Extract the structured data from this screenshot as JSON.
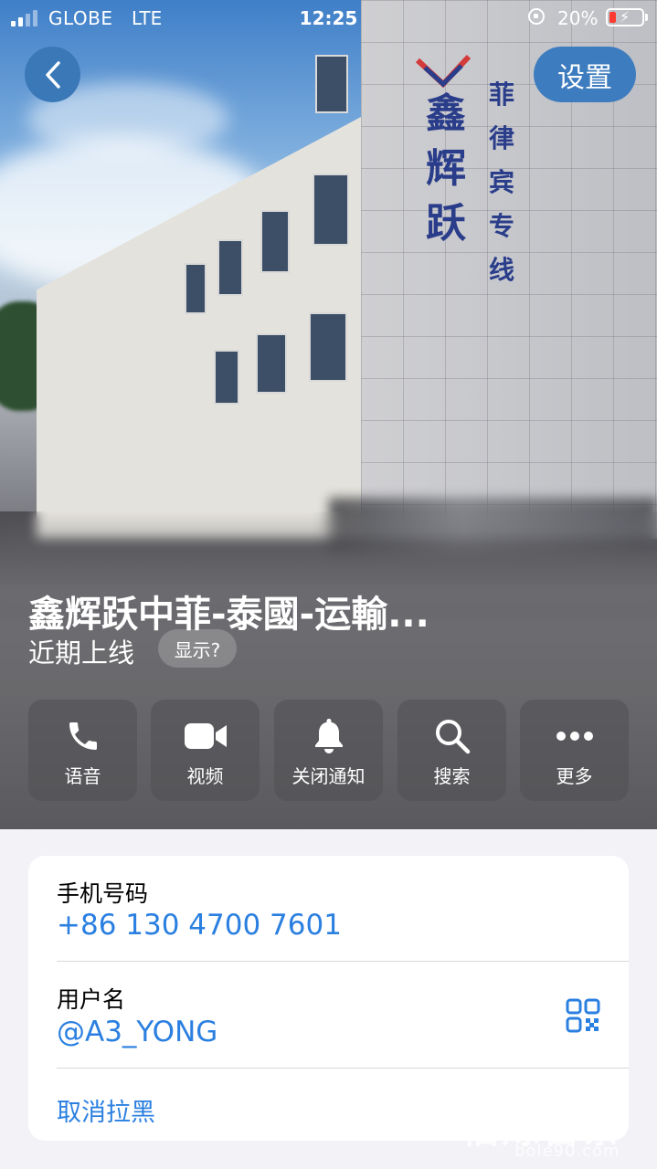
{
  "status_bar": {
    "carrier": "GLOBE",
    "network": "LTE",
    "time": "12:25",
    "battery_percent_label": "20%",
    "battery_level": 0.2,
    "battery_color": "#ff3b30",
    "signal_bars_active": 2
  },
  "nav": {
    "back_icon": "chevron-left-icon",
    "settings_label": "设置"
  },
  "contact": {
    "name": "鑫辉跃中菲-泰國-运輸...",
    "status": "近期上线",
    "show_chip_label": "显示?"
  },
  "actions": [
    {
      "label": "语音",
      "icon": "phone-icon"
    },
    {
      "label": "视频",
      "icon": "video-camera-icon"
    },
    {
      "label": "关闭通知",
      "icon": "bell-icon"
    },
    {
      "label": "搜索",
      "icon": "search-icon"
    },
    {
      "label": "更多",
      "icon": "more-icon"
    }
  ],
  "info": {
    "phone_label": "手机号码",
    "phone_value": "+86 130 4700 7601",
    "username_label": "用户名",
    "username_value": "@A3_YONG",
    "qr_icon": "qr-code-icon",
    "unblock_label": "取消拉黑"
  },
  "photo": {
    "sign_main": "鑫辉跃",
    "sign_sub": "菲律宾专线"
  },
  "watermark": {
    "text": "佰烁百条",
    "url": "bole90.com"
  },
  "colors": {
    "accent": "#2a7fe0",
    "button_blue": "#3a78b8",
    "background": "#f2f2f7"
  }
}
